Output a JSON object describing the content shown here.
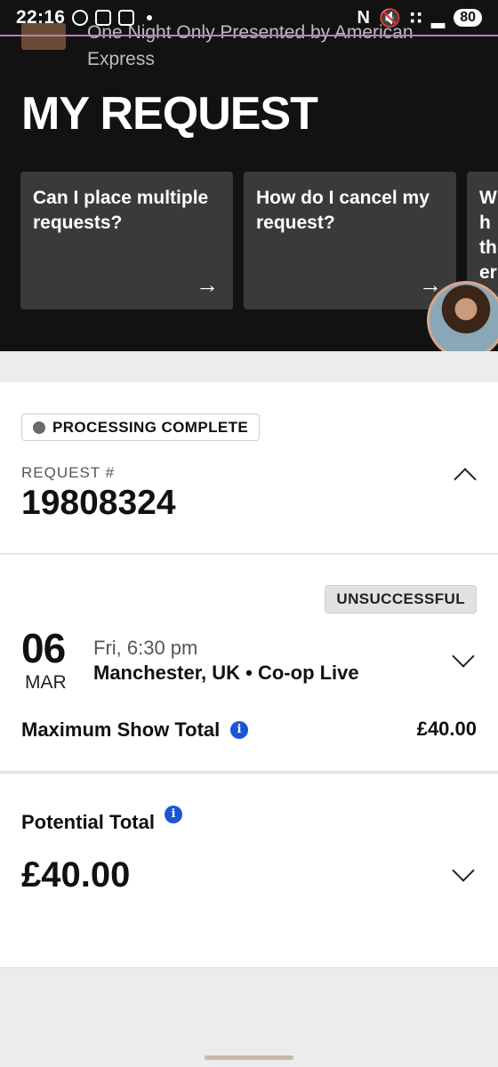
{
  "status_bar": {
    "time": "22:16",
    "battery": "80"
  },
  "header": {
    "event_title": "One Night Only Presented by American Express",
    "page_title": "MY REQUEST"
  },
  "faq_cards": [
    {
      "question": "Can I place multiple requests?"
    },
    {
      "question": "How do I cancel my request?"
    },
    {
      "question": "Wh th er"
    }
  ],
  "request": {
    "status": "PROCESSING COMPLETE",
    "number_label": "REQUEST #",
    "number": "19808324"
  },
  "show": {
    "result_badge": "UNSUCCESSFUL",
    "day": "06",
    "month": "MAR",
    "time": "Fri, 6:30 pm",
    "venue": "Manchester, UK • Co-op Live",
    "max_total_label": "Maximum Show Total",
    "max_total_value": "£40.00"
  },
  "total": {
    "label": "Potential Total",
    "value": "£40.00"
  },
  "icons": {
    "info": "info-icon",
    "arrow": "arrow-right-icon",
    "chevron_up": "chevron-up-icon",
    "chevron_down": "chevron-down-icon"
  },
  "colors": {
    "header_bg": "#121212",
    "card_bg": "#3a3a3a",
    "info_blue": "#1a55d6"
  }
}
